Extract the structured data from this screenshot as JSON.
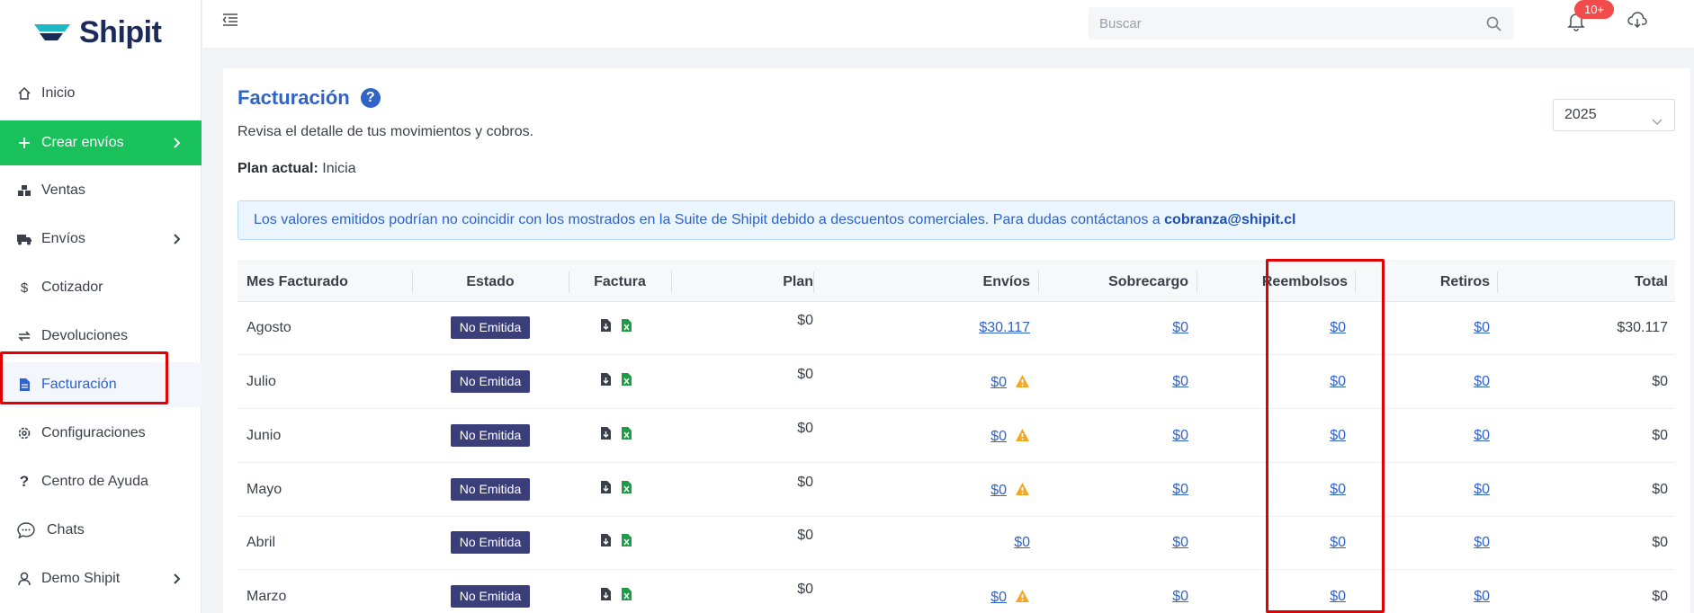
{
  "brand": {
    "name": "Shipit"
  },
  "sidebar": {
    "items": [
      {
        "label": "Inicio",
        "icon": "home-icon"
      },
      {
        "label": "Crear envíos",
        "icon": "plus-icon"
      },
      {
        "label": "Ventas",
        "icon": "boxes-icon"
      },
      {
        "label": "Envíos",
        "icon": "truck-icon"
      },
      {
        "label": "Cotizador",
        "icon": "dollar-icon"
      },
      {
        "label": "Devoluciones",
        "icon": "return-icon"
      },
      {
        "label": "Facturación",
        "icon": "invoice-icon"
      },
      {
        "label": "Configuraciones",
        "icon": "gear-icon"
      },
      {
        "label": "Centro de Ayuda",
        "icon": "question-icon"
      },
      {
        "label": "Chats",
        "icon": "chat-icon"
      },
      {
        "label": "Demo Shipit",
        "icon": "user-icon"
      }
    ]
  },
  "topbar": {
    "search_placeholder": "Buscar",
    "notifications_badge": "10+"
  },
  "page": {
    "title": "Facturación",
    "subtitle": "Revisa el detalle de tus movimientos y cobros.",
    "plan_label": "Plan actual:",
    "plan_value": "Inicia",
    "year": "2025",
    "alert_text": "Los valores emitidos podrían no coincidir con los mostrados en la Suite de Shipit debido a descuentos comerciales. Para dudas contáctanos a",
    "alert_email": "cobranza@shipit.cl"
  },
  "table": {
    "headers": {
      "mes": "Mes Facturado",
      "estado": "Estado",
      "factura": "Factura",
      "plan": "Plan",
      "envios": "Envíos",
      "sobrecargo": "Sobrecargo",
      "reembolsos": "Reembolsos",
      "retiros": "Retiros",
      "total": "Total"
    },
    "rows": [
      {
        "mes": "Agosto",
        "estado": "No Emitida",
        "plan": "$0",
        "envios": "$30.117",
        "sobrecargo": "$0",
        "reembolsos": "$0",
        "retiros": "$0",
        "total": "$30.117"
      },
      {
        "mes": "Julio",
        "estado": "No Emitida",
        "plan": "$0",
        "envios": "$0",
        "sobrecargo": "$0",
        "reembolsos": "$0",
        "retiros": "$0",
        "total": "$0"
      },
      {
        "mes": "Junio",
        "estado": "No Emitida",
        "plan": "$0",
        "envios": "$0",
        "sobrecargo": "$0",
        "reembolsos": "$0",
        "retiros": "$0",
        "total": "$0"
      },
      {
        "mes": "Mayo",
        "estado": "No Emitida",
        "plan": "$0",
        "envios": "$0",
        "sobrecargo": "$0",
        "reembolsos": "$0",
        "retiros": "$0",
        "total": "$0"
      },
      {
        "mes": "Abril",
        "estado": "No Emitida",
        "plan": "$0",
        "envios": "$0",
        "sobrecargo": "$0",
        "reembolsos": "$0",
        "retiros": "$0",
        "total": "$0"
      },
      {
        "mes": "Marzo",
        "estado": "No Emitida",
        "plan": "$0",
        "envios": "$0",
        "sobrecargo": "$0",
        "reembolsos": "$0",
        "retiros": "$0",
        "total": "$0"
      }
    ]
  },
  "colors": {
    "accent": "#2f63c8",
    "primary_green": "#18c15a",
    "badge_red": "#f24b4b",
    "status_badge": "#3a3f7a",
    "warning": "#f5a623",
    "highlight_red": "#e30000"
  }
}
